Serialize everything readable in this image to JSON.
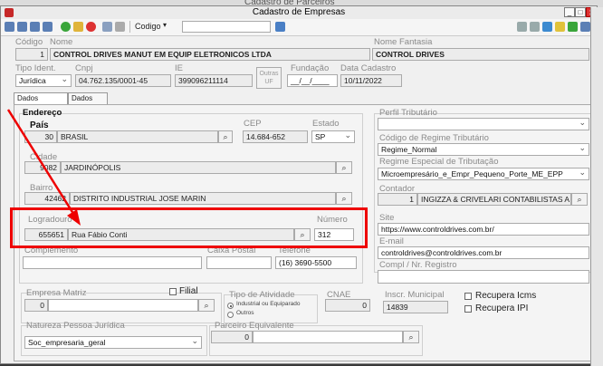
{
  "bg_window": {
    "title": "Cadastro de Parceiros"
  },
  "window": {
    "title": "Cadastro de Empresas",
    "buttons": [
      "_",
      "□",
      "x"
    ]
  },
  "toolbar": {
    "search_field_label": "Codigo",
    "search_value": ""
  },
  "header": {
    "codigo_label": "Código",
    "nome_label": "Nome",
    "nome_fantasia_label": "Nome Fantasia",
    "codigo": "1",
    "nome": "CONTROL DRIVES MANUT EM EQUIP ELETRONICOS LTDA",
    "nome_fantasia": "CONTROL DRIVES",
    "tipo_ident_label": "Tipo Ident.",
    "cnpj_label": "Cnpj",
    "ie_label": "IE",
    "outras_uf_label": "Outras UF",
    "fundacao_label": "Fundação",
    "data_cadastro_label": "Data Cadastro",
    "tipo_ident": "Jurídica",
    "cnpj": "04.762.135/0001-45",
    "ie": "399096211114",
    "fundacao": "__/__/____",
    "data_cadastro": "10/11/2022"
  },
  "tabs": [
    {
      "label": "Dados Principais"
    },
    {
      "label": "Dados Aux."
    }
  ],
  "endereco": {
    "title": "Endereço",
    "pais_label": "País",
    "pais_codigo": "30",
    "pais_nome": "BRASIL",
    "cep_label": "CEP",
    "cep": "14.684-652",
    "estado_label": "Estado",
    "estado": "SP",
    "cidade_label": "Cidade",
    "cidade_codigo": "9082",
    "cidade_nome": "JARDINÓPOLIS",
    "bairro_label": "Bairro",
    "bairro_codigo": "42462",
    "bairro_nome": "DISTRITO INDUSTRIAL JOSE MARIN",
    "logradouro_label": "Logradouro",
    "logradouro_codigo": "655651",
    "logradouro_nome": "Rua Fábio Conti",
    "numero_label": "Número",
    "numero": "312",
    "complemento_label": "Complemento",
    "complemento": "",
    "caixa_postal_label": "Caixa Postal",
    "caixa_postal": "",
    "telefone_label": "Telefone",
    "telefone": "(16) 3690-5500"
  },
  "right_panel": {
    "perfil_label": "Perfil Tributário",
    "perfil": "",
    "codigo_regime_label": "Código de Regime Tributário",
    "codigo_regime": "Regime_Normal",
    "regime_especial_label": "Regime Especial de Tributação",
    "regime_especial": "Microempresário_e_Empr_Pequeno_Porte_ME_EPP",
    "contador_label": "Contador",
    "contador_codigo": "1",
    "contador_nome": "INGIZZA & CRIVELARI CONTABILISTAS A",
    "site_label": "Site",
    "site": "https://www.controldrives.com.br/",
    "email_label": "E-mail",
    "email": "controldrives@controldrives.com.br",
    "compl_registro_label": "Compl / Nr. Registro",
    "compl_registro": ""
  },
  "bottom": {
    "empresa_matriz_label": "Empresa Matriz",
    "empresa_matriz_codigo": "0",
    "filial_label": "Filial",
    "tipo_atividade_label": "Tipo de Atividade",
    "tipo_atividade_options": [
      "Industrial ou Equiparado",
      "Outros"
    ],
    "cnae_label": "CNAE",
    "cnae": "0",
    "inscr_municipal_label": "Inscr. Municipal",
    "inscr_municipal": "14839",
    "recupera_icms_label": "Recupera Icms",
    "recupera_ipi_label": "Recupera IPI",
    "natureza_label": "Natureza Pessoa Jurídica",
    "natureza": "Soc_empresaria_geral",
    "parceiro_label": "Parceiro Equivalente",
    "parceiro_codigo": "0"
  },
  "colors": {
    "highlight": "#e00000",
    "readonly_bg": "#ececec"
  }
}
